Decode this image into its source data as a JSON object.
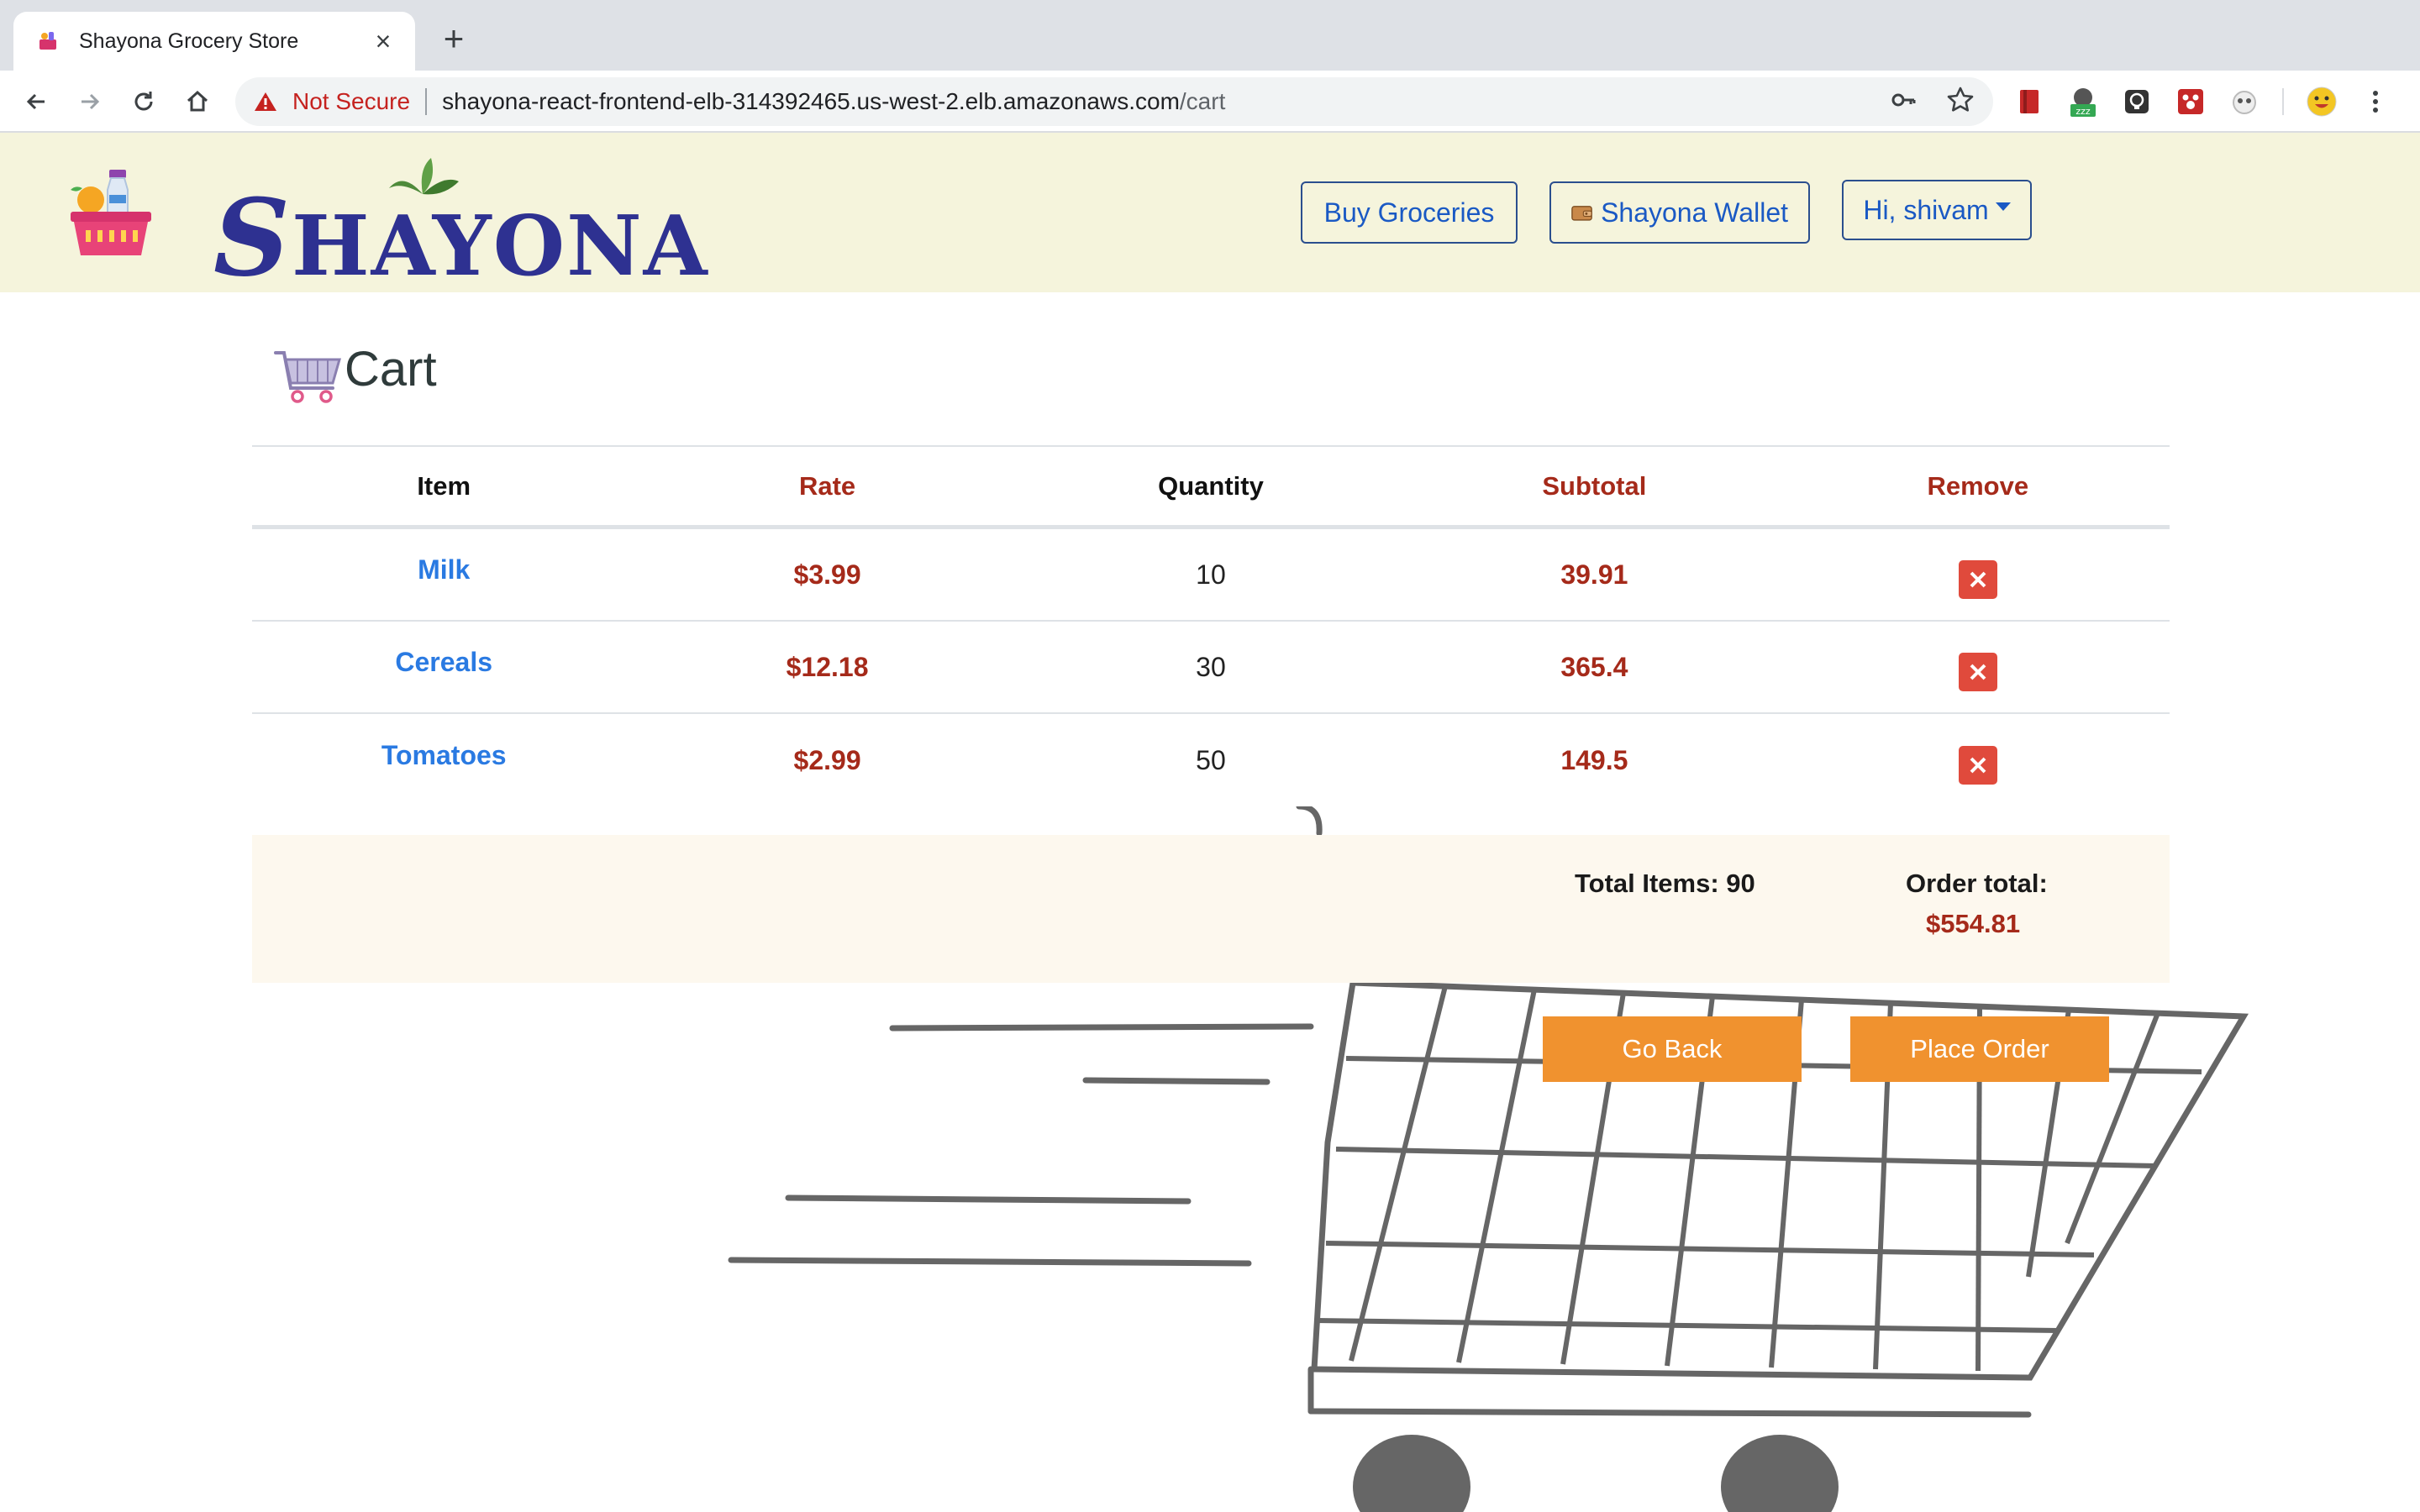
{
  "browser": {
    "tab_title": "Shayona Grocery Store",
    "new_tab": "+",
    "close": "×",
    "security_label": "Not Secure",
    "url_host": "shayona-react-frontend-elb-314392465.us-west-2.elb.amazonaws.com",
    "url_path": "/cart",
    "extension_badge": "zzz"
  },
  "header": {
    "brand_first": "S",
    "brand_rest": "HAYONA",
    "buy_groceries": "Buy Groceries",
    "wallet": "Shayona Wallet",
    "user_menu": "Hi, shivam"
  },
  "cart": {
    "title": "Cart",
    "columns": [
      "Item",
      "Rate",
      "Quantity",
      "Subtotal",
      "Remove"
    ],
    "rows": [
      {
        "item": "Milk",
        "rate": "$3.99",
        "quantity": "10",
        "subtotal": "39.91"
      },
      {
        "item": "Cereals",
        "rate": "$12.18",
        "quantity": "30",
        "subtotal": "365.4"
      },
      {
        "item": "Tomatoes",
        "rate": "$2.99",
        "quantity": "50",
        "subtotal": "149.5"
      }
    ],
    "total_items": "Total Items: 90",
    "order_total_label": "Order total:",
    "order_total_value": "$554.81",
    "go_back": "Go Back",
    "place_order": "Place Order"
  },
  "colors": {
    "header_bg": "#f5f4dc",
    "brand_blue": "#2e3191",
    "link_blue": "#2a7ae2",
    "price_red": "#a52a1a",
    "action_orange": "#f0922f",
    "remove_red": "#e04a3c",
    "summary_bg": "#fdf8ee"
  }
}
